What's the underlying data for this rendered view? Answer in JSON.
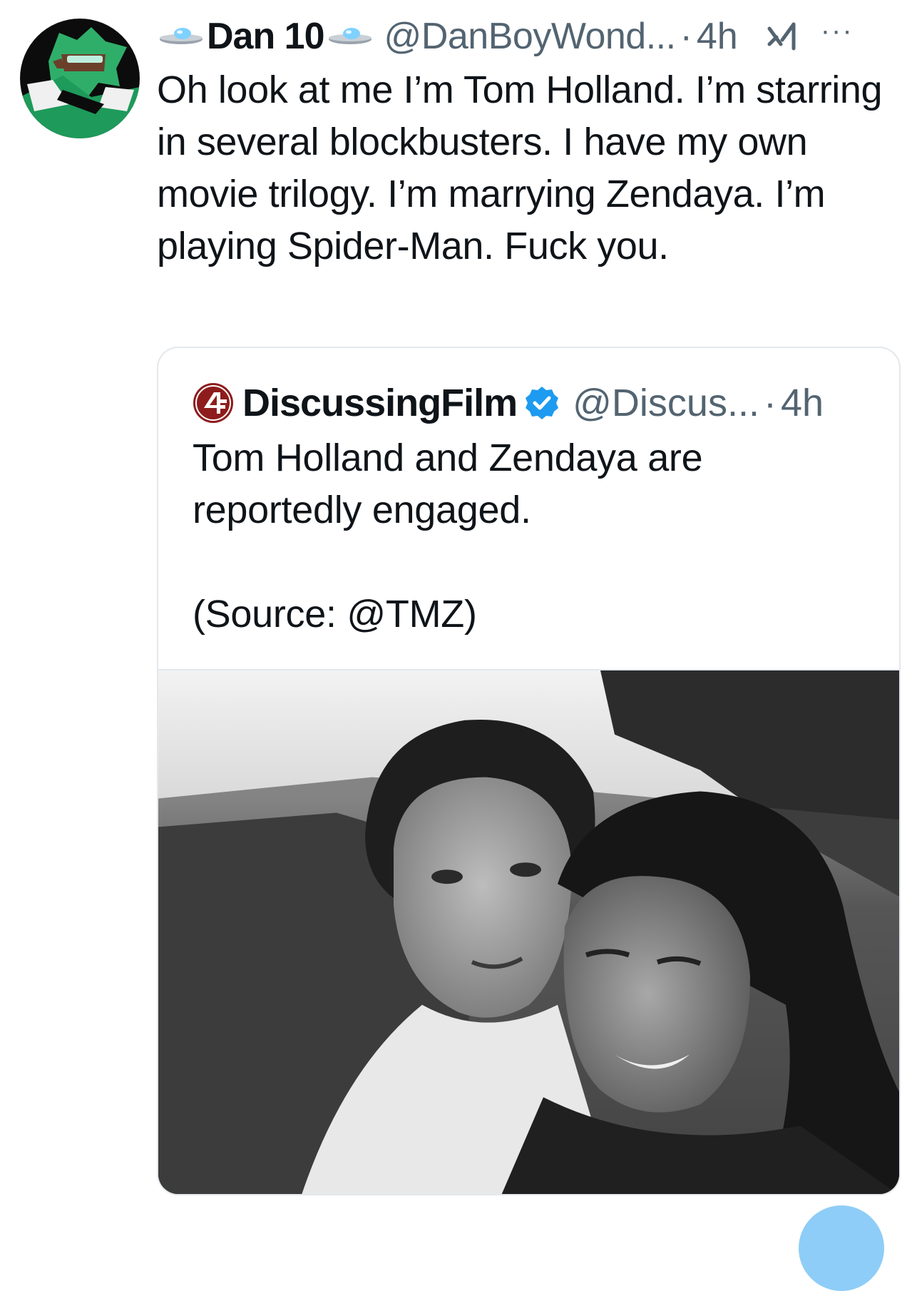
{
  "tweet": {
    "display_name": "Dan 10",
    "handle": "@DanBoyWond...",
    "dot": "·",
    "time": "4h",
    "more": "···",
    "text": "Oh look at me I’m Tom Holland. I’m starring in several blockbusters. I have my own movie trilogy. I’m marrying Zendaya. I’m playing Spider-Man. Fuck you."
  },
  "quote": {
    "display_name": "DiscussingFilm",
    "handle": "@Discus...",
    "dot": "·",
    "time": "4h",
    "text": "Tom Holland and Zendaya are\nreportedly engaged.\n\n(Source: @TMZ)"
  },
  "colors": {
    "text": "#0f1419",
    "secondary": "#536471",
    "verified": "#1d9bf0",
    "border": "#e3e8ec",
    "logo_red": "#8e1c1c"
  },
  "icons": {
    "avatar": "cartoon-avatar",
    "ufo": "ufo-emoji-icon",
    "grok": "grok-icon",
    "more": "more-options-icon",
    "logo": "discussingfilm-logo",
    "verified": "verified-badge-icon"
  }
}
